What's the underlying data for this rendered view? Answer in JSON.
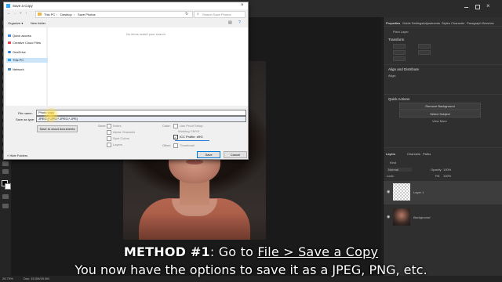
{
  "dialog": {
    "title": "Save a Copy",
    "breadcrumb": [
      "This PC",
      "Desktop",
      "Save Photos"
    ],
    "search_placeholder": "Search Save Photos",
    "toolbar": {
      "organize": "Organize ▾",
      "new_folder": "New folder"
    },
    "nav_items": [
      "Quick access",
      "Creative Cloud Files",
      "OneDrive",
      "This PC",
      "Network"
    ],
    "empty_message": "No items match your search.",
    "file_name_label": "File name:",
    "file_name_value": "Photo copy",
    "save_as_type_label": "Save as type:",
    "save_as_type_value": "JPEG (*.JPG;*.JPEG;*.JPE)",
    "cloud_button": "Save to cloud documents",
    "save_section": "Save:",
    "save_options": [
      "Notes",
      "Alpha Channels",
      "Spot Colors",
      "Layers"
    ],
    "color_section": "Color:",
    "color_options": [
      "Use Proof Setup:",
      "Working CMYK"
    ],
    "icc_label": "ICC Profile:",
    "icc_value": "sRG",
    "other_section": "Other:",
    "thumbnail_label": "Thumbnail",
    "hide_folders": "Hide Folders",
    "save_button": "Save",
    "cancel_button": "Cancel"
  },
  "ps": {
    "panel_tabs": [
      "Properties",
      "Guide Settings",
      "Adjustments",
      "Styles",
      "Character",
      "Paragraph",
      "Brushes"
    ],
    "pixel_layer": "Pixel Layer",
    "transform": "Transform",
    "align_distribute": "Align and Distribute",
    "align_label": "Align:",
    "quick_actions": "Quick Actions",
    "remove_background": "Remove Background",
    "select_subject": "Select Subject",
    "view_more": "View More",
    "layers_tabs": [
      "Layers",
      "Channels",
      "Paths"
    ],
    "blend_mode": "Normal",
    "opacity_label": "Opacity:",
    "opacity_value": "100%",
    "fill_label": "Fill:",
    "fill_value": "100%",
    "lock_label": "Lock:",
    "kind_label": "Kind",
    "layers": [
      "Layer 1",
      "Background"
    ],
    "zoom": "26.79%",
    "doc_info": "Doc: 15.0M/15.0M"
  },
  "caption": {
    "method": "METHOD #1",
    "goto": ": Go to ",
    "menu_path": "File > Save a Copy",
    "line2": "You now have the options to save it as a JPEG, PNG, etc."
  }
}
